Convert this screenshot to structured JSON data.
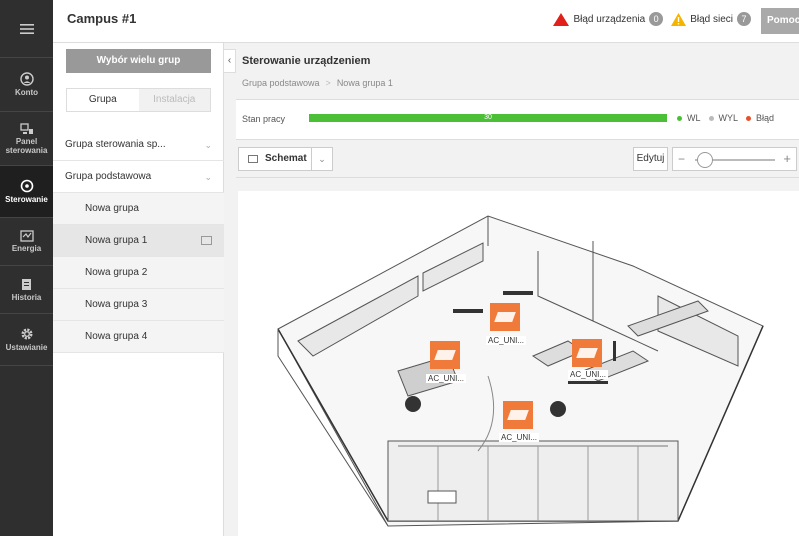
{
  "nav": {
    "items": [
      {
        "label": "",
        "icon": "hamburger-icon"
      },
      {
        "label": "Konto",
        "icon": "user-icon"
      },
      {
        "label": "Panel sterowania",
        "icon": "dashboard-icon"
      },
      {
        "label": "Sterowanie",
        "icon": "control-icon"
      },
      {
        "label": "Energia",
        "icon": "energy-icon"
      },
      {
        "label": "Historia",
        "icon": "history-icon"
      },
      {
        "label": "Ustawianie",
        "icon": "settings-icon"
      }
    ]
  },
  "header": {
    "title": "Campus #1",
    "device_error_label": "Błąd urządzenia",
    "device_error_count": "0",
    "network_error_label": "Błąd sieci",
    "network_error_count": "7",
    "help_label": "Pomoc"
  },
  "left_panel": {
    "multi_select_label": "Wybór wielu grup",
    "tabs": [
      "Grupa",
      "Instalacja"
    ],
    "groups": [
      {
        "label": "Grupa sterowania sp..."
      },
      {
        "label": "Grupa podstawowa"
      }
    ],
    "children": [
      {
        "label": "Nowa grupa"
      },
      {
        "label": "Nowa grupa 1"
      },
      {
        "label": "Nowa grupa 2"
      },
      {
        "label": "Nowa grupa 3"
      },
      {
        "label": "Nowa grupa 4"
      }
    ]
  },
  "main": {
    "title": "Sterowanie urządzeniem",
    "breadcrumb": [
      "Grupa podstawowa",
      "Nowa grupa 1"
    ],
    "status_label": "Stan pracy",
    "status_value": "30",
    "legend": [
      {
        "label": "WL",
        "color": "#4bbf35"
      },
      {
        "label": "WYL",
        "color": "#bbbbbb"
      },
      {
        "label": "Błąd",
        "color": "#e8502a"
      }
    ],
    "view_label": "Schemat",
    "edit_label": "Edytuj",
    "units": [
      {
        "label": "AC_UNI..."
      },
      {
        "label": "AC_UNI..."
      },
      {
        "label": "AC_UNI..."
      },
      {
        "label": "AC_UNI..."
      }
    ]
  }
}
